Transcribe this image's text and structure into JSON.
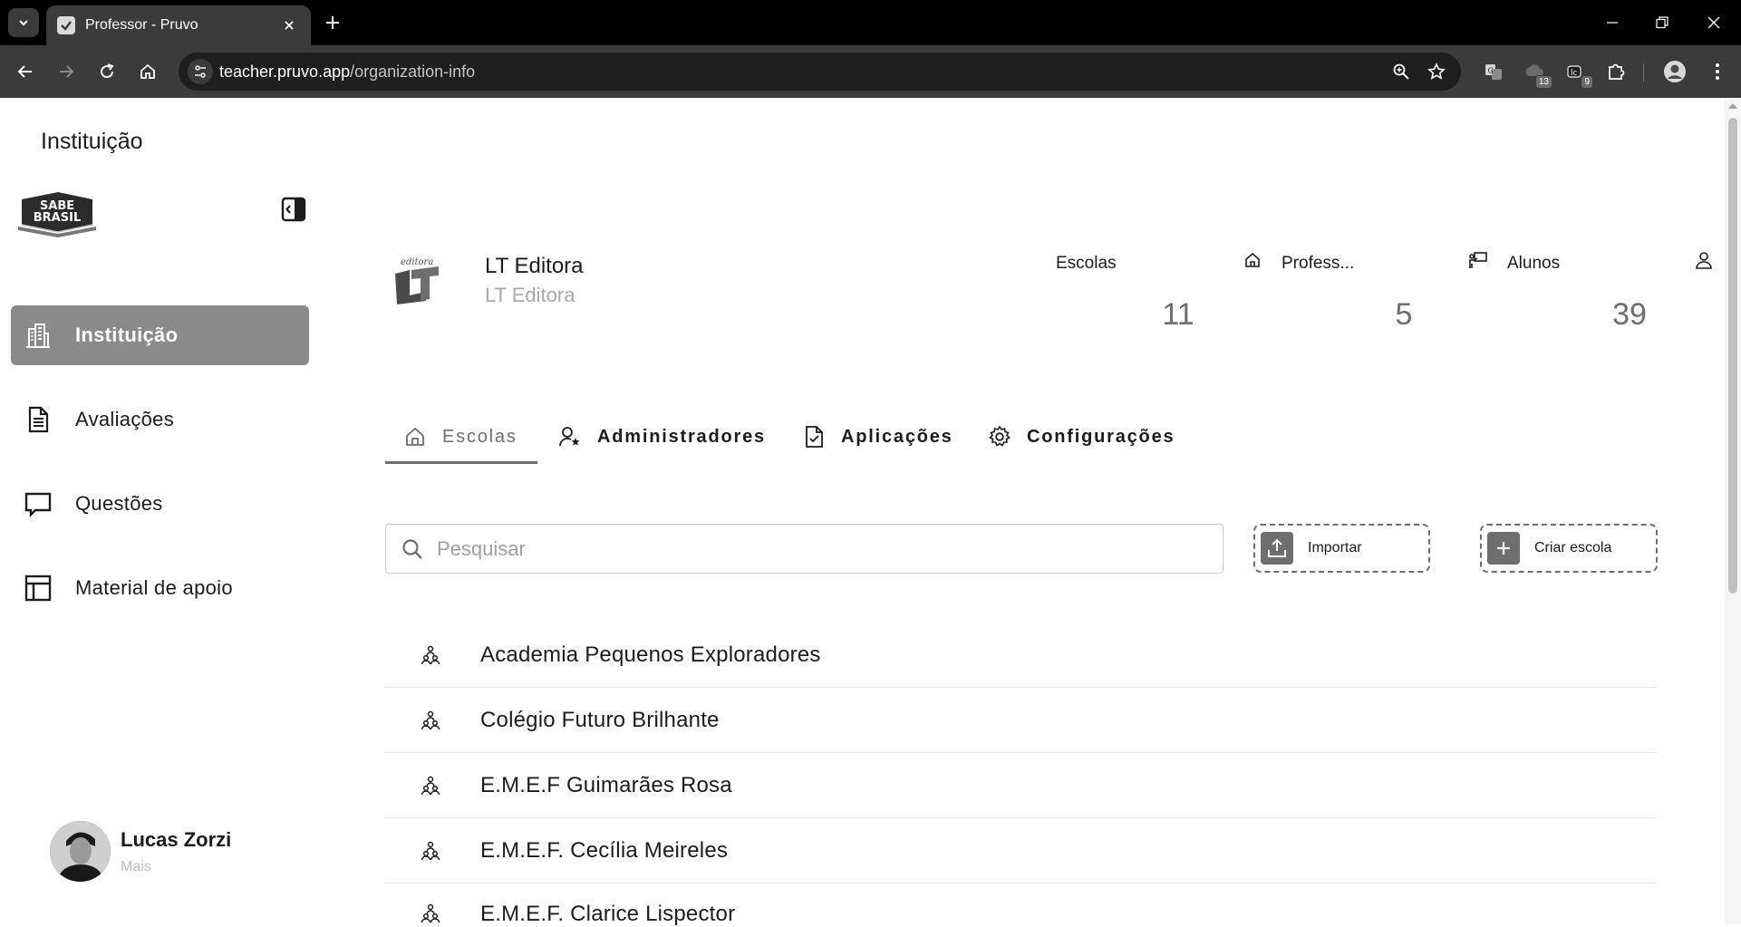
{
  "browser": {
    "tab_title": "Professor - Pruvo",
    "url_host": "teacher.pruvo.app",
    "url_path": "/organization-info",
    "extensions": [
      {
        "name": "translate-extension",
        "badge": ""
      },
      {
        "name": "cloud-extension",
        "badge": "13"
      },
      {
        "name": "counter-extension",
        "badge": "9"
      }
    ]
  },
  "sidebar": {
    "heading": "Instituição",
    "logo_text": [
      "SABE",
      "BRASIL"
    ],
    "items": [
      {
        "label": "Instituição",
        "icon": "building-icon",
        "active": true
      },
      {
        "label": "Avaliações",
        "icon": "document-icon",
        "active": false
      },
      {
        "label": "Questões",
        "icon": "chat-bubble-icon",
        "active": false
      },
      {
        "label": "Material de apoio",
        "icon": "layout-icon",
        "active": false
      }
    ],
    "user": {
      "name": "Lucas Zorzi",
      "more": "Mais"
    }
  },
  "organization": {
    "logo_text": "editora",
    "name": "LT Editora",
    "subtitle": "LT Editora",
    "stats": [
      {
        "label": "Escolas",
        "value": "11",
        "icon": "home-icon"
      },
      {
        "label": "Profess...",
        "value": "5",
        "icon": "teacher-board-icon"
      },
      {
        "label": "Alunos",
        "value": "39",
        "icon": "person-icon"
      }
    ]
  },
  "tabs": [
    {
      "label": "Escolas",
      "icon": "home-icon",
      "selected": true
    },
    {
      "label": "Administradores",
      "icon": "admin-user-icon",
      "selected": false
    },
    {
      "label": "Aplicações",
      "icon": "checked-document-icon",
      "selected": false
    },
    {
      "label": "Configurações",
      "icon": "gear-icon",
      "selected": false
    }
  ],
  "search": {
    "placeholder": "Pesquisar",
    "value": ""
  },
  "actions": {
    "import_label": "Importar",
    "create_label": "Criar escola"
  },
  "schools": [
    "Academia Pequenos Exploradores",
    "Colégio Futuro Brilhante",
    "E.M.E.F Guimarães Rosa",
    "E.M.E.F. Cecília Meireles",
    "E.M.E.F. Clarice Lispector"
  ]
}
